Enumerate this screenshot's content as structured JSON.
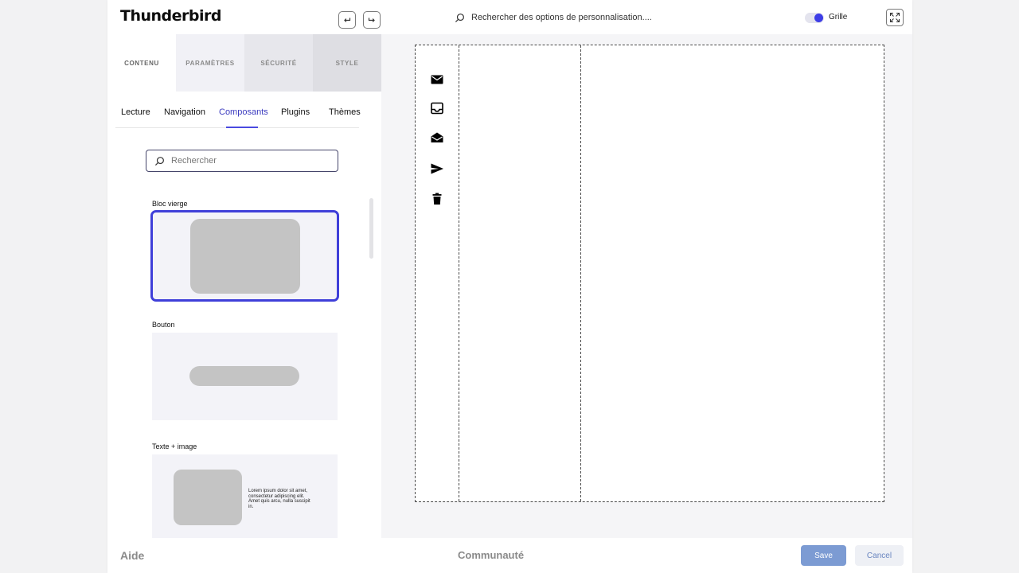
{
  "app": {
    "title": "Thunderbird"
  },
  "header": {
    "search_placeholder": "Rechercher des options de personnalisation....",
    "grid_toggle_label": "Grille",
    "grid_enabled": true,
    "accent_color": "#3d3de6"
  },
  "main_tabs": [
    {
      "label": "CONTENU"
    },
    {
      "label": "PARAMÈTRES"
    },
    {
      "label": "SÉCURITÉ"
    },
    {
      "label": "STYLE"
    }
  ],
  "sub_tabs": [
    {
      "label": "Lecture"
    },
    {
      "label": "Navigation"
    },
    {
      "label": "Composants",
      "active": true
    },
    {
      "label": "Plugins"
    },
    {
      "label": "Thèmes"
    }
  ],
  "components": {
    "search_placeholder": "Rechercher",
    "items": [
      {
        "label": "Bloc vierge",
        "selected": true
      },
      {
        "label": "Bouton"
      },
      {
        "label": "Texte + image",
        "text": "Lorem ipsum dolor sit amet, consectetur adipiscing elit. Amet quis arcu, nulla suscipit in."
      }
    ]
  },
  "canvas": {
    "rail_icons": [
      "mail-icon",
      "inbox-icon",
      "open-mail-icon",
      "send-icon",
      "trash-icon"
    ]
  },
  "footer": {
    "help_label": "Aide",
    "community_label": "Communauté",
    "save_label": "Save",
    "cancel_label": "Cancel"
  }
}
